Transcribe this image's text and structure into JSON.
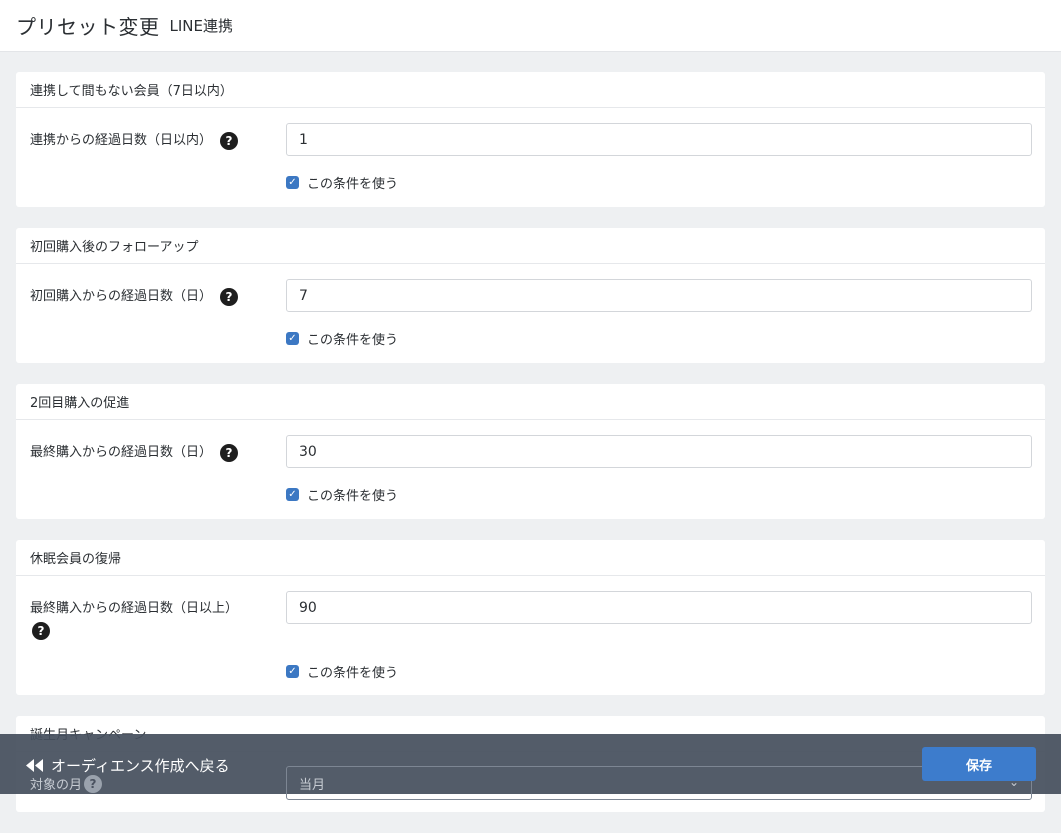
{
  "header": {
    "title": "プリセット変更",
    "subtitle": "LINE連携"
  },
  "cards": [
    {
      "title": "連携して間もない会員（7日以内）",
      "field_label": "連携からの経過日数（日以内）",
      "value": "1",
      "checkbox_label": "この条件を使う",
      "checked": true
    },
    {
      "title": "初回購入後のフォローアップ",
      "field_label": "初回購入からの経過日数（日）",
      "value": "7",
      "checkbox_label": "この条件を使う",
      "checked": true
    },
    {
      "title": "2回目購入の促進",
      "field_label": "最終購入からの経過日数（日）",
      "value": "30",
      "checkbox_label": "この条件を使う",
      "checked": true
    },
    {
      "title": "休眠会員の復帰",
      "field_label": "最終購入からの経過日数（日以上）",
      "value": "90",
      "checkbox_label": "この条件を使う",
      "checked": true
    },
    {
      "title": "誕生月キャンペーン",
      "field_label": "対象の月",
      "select_value": "当月"
    }
  ],
  "footer": {
    "back_label": "オーディエンス作成へ戻る",
    "save_label": "保存"
  },
  "icons": {
    "help": "question-circle-icon",
    "back": "backward-icon",
    "check": "check-icon",
    "dropdown": "chevron-down-icon"
  },
  "colors": {
    "accent": "#3d7ccc",
    "checkbox": "#3c78c3",
    "footer_bg": "#46505e",
    "page_bg": "#eef0f2"
  }
}
